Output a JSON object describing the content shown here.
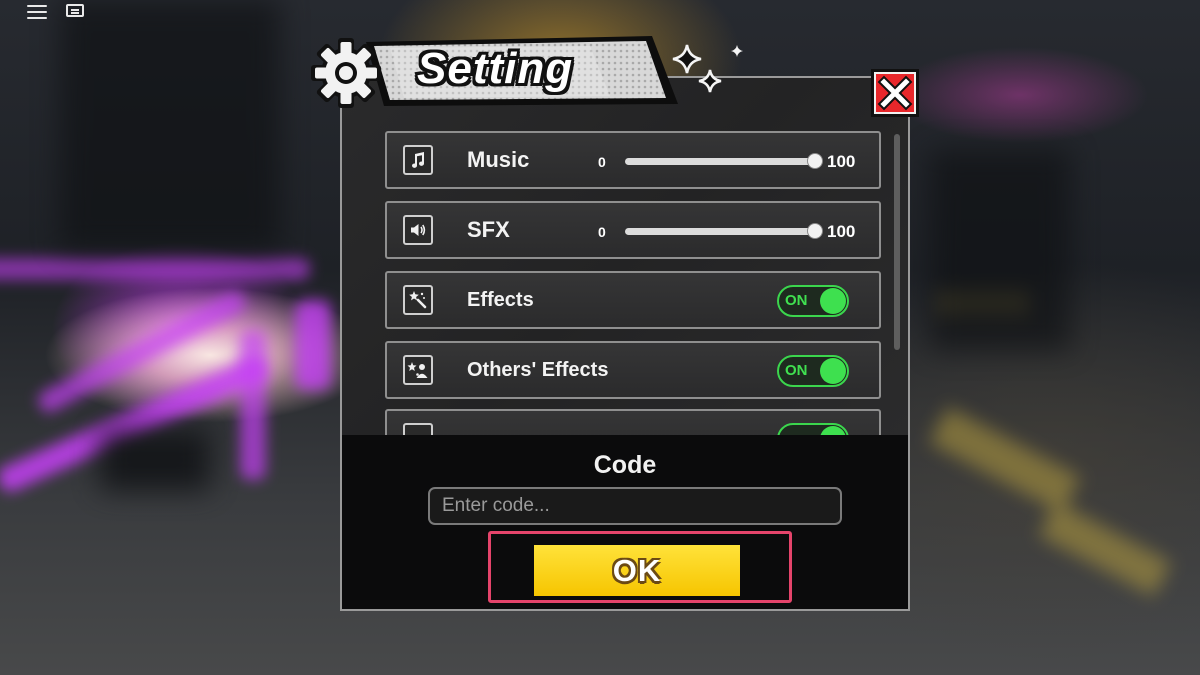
{
  "hud": {
    "menu_icon": "hamburger-menu-icon",
    "chat_icon": "chat-icon"
  },
  "settings": {
    "title": "Setting",
    "title_icon": "gear-icon",
    "close_icon": "close-x-icon",
    "rows": {
      "music": {
        "label": "Music",
        "icon": "music-note-icon",
        "min": "0",
        "max": "100",
        "value": 100
      },
      "sfx": {
        "label": "SFX",
        "icon": "speaker-icon",
        "min": "0",
        "max": "100",
        "value": 100
      },
      "effects": {
        "label": "Effects",
        "icon": "magic-wand-icon",
        "toggle": "ON"
      },
      "others_effects": {
        "label": "Others' Effects",
        "icon": "sparkle-user-icon",
        "toggle": "ON"
      }
    },
    "code": {
      "title": "Code",
      "placeholder": "Enter code...",
      "ok_label": "OK"
    }
  },
  "colors": {
    "accent_yellow": "#f6c500",
    "toggle_green": "#3ee04f",
    "close_red": "#e8272b",
    "highlight_pink": "#e5446b"
  }
}
